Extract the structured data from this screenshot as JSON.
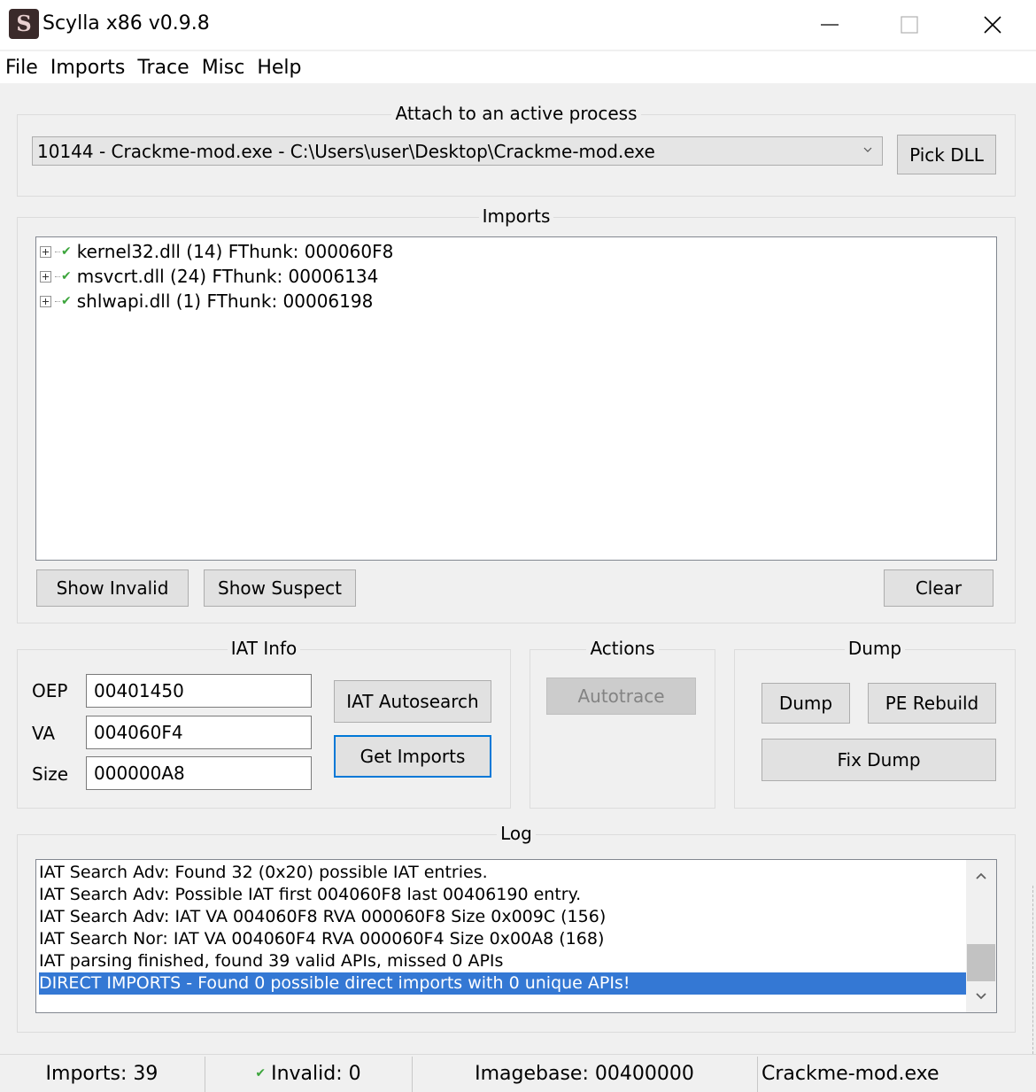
{
  "window": {
    "title": "Scylla x86 v0.9.8",
    "icon_letter": "S"
  },
  "menu": [
    "File",
    "Imports",
    "Trace",
    "Misc",
    "Help"
  ],
  "attach": {
    "title": "Attach to an active process",
    "process_value": "10144 - Crackme-mod.exe - C:\\Users\\user\\Desktop\\Crackme-mod.exe",
    "pick_dll_label": "Pick DLL"
  },
  "imports": {
    "title": "Imports",
    "items": [
      "kernel32.dll (14) FThunk: 000060F8",
      "msvcrt.dll (24) FThunk: 00006134",
      "shlwapi.dll (1) FThunk: 00006198"
    ],
    "show_invalid_label": "Show Invalid",
    "show_suspect_label": "Show Suspect",
    "clear_label": "Clear"
  },
  "iat_info": {
    "title": "IAT Info",
    "oep_label": "OEP",
    "oep_value": "00401450",
    "va_label": "VA",
    "va_value": "004060F4",
    "size_label": "Size",
    "size_value": "000000A8",
    "autosearch_label": "IAT Autosearch",
    "get_imports_label": "Get Imports"
  },
  "actions": {
    "title": "Actions",
    "autotrace_label": "Autotrace"
  },
  "dump": {
    "title": "Dump",
    "dump_label": "Dump",
    "pe_rebuild_label": "PE Rebuild",
    "fix_dump_label": "Fix Dump"
  },
  "log": {
    "title": "Log",
    "lines": [
      "IAT Search Adv: Found 32 (0x20) possible IAT entries.",
      "IAT Search Adv: Possible IAT first 004060F8 last 00406190 entry.",
      "IAT Search Adv: IAT VA 004060F8 RVA 000060F8 Size 0x009C (156)",
      "IAT Search Nor: IAT VA 004060F4 RVA 000060F4 Size 0x00A8 (168)",
      "IAT parsing finished, found 39 valid APIs, missed 0 APIs",
      "DIRECT IMPORTS - Found 0 possible direct imports with 0 unique APIs!"
    ],
    "selected_index": 5
  },
  "status": {
    "imports": "Imports: 39",
    "invalid": "Invalid: 0",
    "imagebase": "Imagebase: 00400000",
    "module": "Crackme-mod.exe"
  },
  "colors": {
    "selection": "#3478d4",
    "check": "#3ca53c",
    "focus_border": "#0078d7"
  }
}
